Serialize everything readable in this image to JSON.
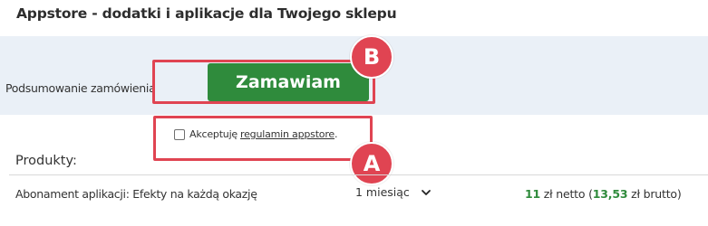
{
  "header": {
    "title": "Appstore - dodatki i aplikacje dla Twojego sklepu"
  },
  "summary": {
    "label": "Podsumowanie zamówienia",
    "order_button": "Zamawiam"
  },
  "callouts": {
    "a": "A",
    "b": "B"
  },
  "terms": {
    "prefix": "Akceptuję",
    "link": "regulamin appstore",
    "suffix": "."
  },
  "products": {
    "heading": "Produkty:",
    "items": [
      {
        "name": "Abonament aplikacji: Efekty na każdą okazję",
        "period": "1 miesiąc",
        "net_value": "11",
        "net_label": "zł netto (",
        "gross_value": "13,53",
        "gross_label": "zł brutto)"
      }
    ]
  },
  "colors": {
    "accent_green": "#2f8b3c",
    "callout_red": "#e04452",
    "band_blue": "#eaf0f7"
  }
}
